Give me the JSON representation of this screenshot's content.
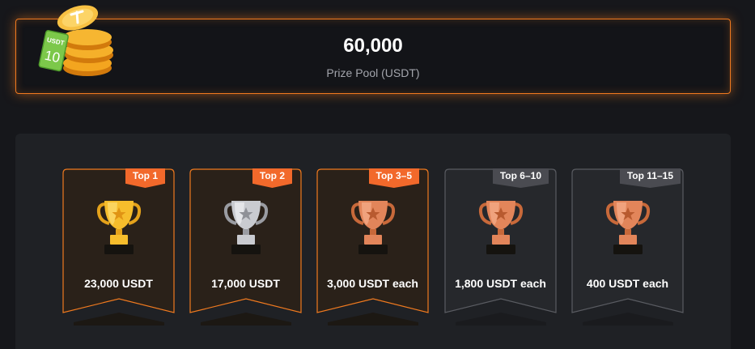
{
  "prize_pool": {
    "amount": "60,000",
    "label": "Prize Pool (USDT)",
    "coin_tag_currency": "USDT",
    "coin_tag_value": "10"
  },
  "tiers": [
    {
      "badge": "Top 1",
      "prize": "23,000 USDT",
      "trophy": "gold-trophy-icon",
      "accent": "#f07a1f"
    },
    {
      "badge": "Top 2",
      "prize": "17,000 USDT",
      "trophy": "silver-trophy-icon",
      "accent": "#f07a1f"
    },
    {
      "badge": "Top 3–5",
      "prize": "3,000 USDT each",
      "trophy": "bronze-trophy-icon",
      "accent": "#f07a1f"
    },
    {
      "badge": "Top 6–10",
      "prize": "1,800 USDT each",
      "trophy": "bronze-trophy-icon",
      "accent": "#5a5c62"
    },
    {
      "badge": "Top 11–15",
      "prize": "400 USDT each",
      "trophy": "bronze-trophy-icon",
      "accent": "#5a5c62"
    }
  ],
  "colors": {
    "accent_orange": "#f07a1f",
    "badge_orange": "#f2692b",
    "badge_gray": "#4a4b51",
    "background": "#16171b"
  }
}
